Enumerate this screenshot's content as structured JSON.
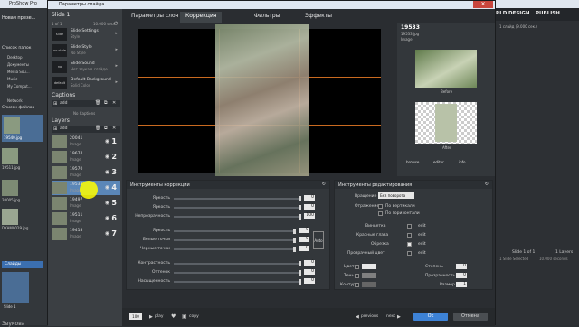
{
  "app": {
    "title": "ProShow Pro",
    "menu_items": [
      "Файл",
      "Правка"
    ],
    "panel_label": "Новая презе...",
    "folder_label": "Список папок",
    "files_label": "Список файлов",
    "tree_items": [
      "Desktop",
      "Документы",
      "Media Sou...",
      "Music",
      "My Comput...",
      "Network"
    ],
    "files": [
      "19540.jpg",
      "19511.jpg",
      "20005.jpg",
      "DKAM0029.jpg"
    ],
    "slides_tab": "Слайды",
    "slide_caption": "Slide 1",
    "right_nav": [
      "RLD",
      "DESIGN",
      "PUBLISH"
    ],
    "right_info": "1 слайд (9.000 сек.)",
    "right_status_1": "Slide 1 of 1",
    "right_status_2": "1 Layers",
    "right_status_3": "1 Slide Selected",
    "right_status_4": "10.000 seconds",
    "bottom_label": "Звукова"
  },
  "dialog": {
    "title": "Параметры слайда",
    "close": "✕",
    "tabs": [
      "Параметры слоя",
      "Коррекция",
      "Фильтры",
      "Эффекты"
    ],
    "active_tab": "Коррекция",
    "sidebar": {
      "slide_title": "Slide 1",
      "slide_meta": "1 of 1",
      "slide_time": "10.000 secs",
      "settings": [
        {
          "icon": "slide settings",
          "title": "Slide Settings",
          "sub": "Style"
        },
        {
          "icon": "no style",
          "title": "Slide Style",
          "sub": "No Style"
        },
        {
          "icon": "no sound",
          "title": "Slide Sound",
          "sub": "Нет звука в слайде"
        },
        {
          "icon": "default",
          "title": "Default Background",
          "sub": "Solid Color"
        }
      ],
      "captions_label": "Captions",
      "captions_add": "add",
      "no_captions": "No Captions",
      "layers_label": "Layers",
      "layers_add": "add",
      "layers": [
        {
          "name": "20041",
          "sub": "Image",
          "num": "1"
        },
        {
          "name": "19674",
          "sub": "Image",
          "num": "2"
        },
        {
          "name": "19570",
          "sub": "Image",
          "num": "3"
        },
        {
          "name": "19533",
          "sub": "Image",
          "num": "4",
          "selected": true
        },
        {
          "name": "19497",
          "sub": "Image",
          "num": "5"
        },
        {
          "name": "19511",
          "sub": "Image",
          "num": "6"
        },
        {
          "name": "19418",
          "sub": "Image",
          "num": "7"
        }
      ]
    },
    "preview": {
      "name": "19533",
      "file": "19533.jpg",
      "kind": "Image",
      "before_label": "Before",
      "after_label": "After",
      "actions": [
        "browse",
        "editor",
        "info"
      ]
    },
    "correction": {
      "header": "Инструменты коррекции",
      "sliders": [
        {
          "label": "Яркость",
          "value": "0"
        },
        {
          "label": "Яркость",
          "value": "0"
        },
        {
          "label": "Непрозрачность",
          "value": "100"
        },
        {
          "label": "Яркость",
          "value": "0"
        },
        {
          "label": "Белые точки",
          "value": "0"
        },
        {
          "label": "Черные точки",
          "value": "0"
        },
        {
          "label": "Контрастность",
          "value": "0"
        },
        {
          "label": "Оттенок",
          "value": "0"
        },
        {
          "label": "Насыщенность",
          "value": "0"
        }
      ],
      "auto_label": "Auto"
    },
    "editing": {
      "header": "Инструменты редактирования",
      "rotation_label": "Вращение",
      "rotation_value": "Без поворота",
      "reflection_label": "Отражение",
      "vertical_label": "По вертикали",
      "horizontal_label": "По горизонтали",
      "rows": [
        {
          "label": "Виньетка",
          "edit": "edit"
        },
        {
          "label": "Красные глаза",
          "edit": "edit"
        },
        {
          "label": "Обрезка",
          "edit": "edit"
        },
        {
          "label": "Прозрачный цвет",
          "edit": "edit"
        }
      ],
      "color_label": "Цвет",
      "strength_label": "Степень",
      "strength_value": "0",
      "tone_label": "Тень",
      "opacity_label": "Прозрачность",
      "opacity_value": "0",
      "outline_label": "Контур",
      "size_label": "Размер",
      "size_value": "1"
    },
    "footer": {
      "zoom": "100",
      "play": "play",
      "copy": "copy",
      "prev": "previous",
      "next": "next",
      "ok": "Ok",
      "cancel": "Отмена"
    }
  }
}
